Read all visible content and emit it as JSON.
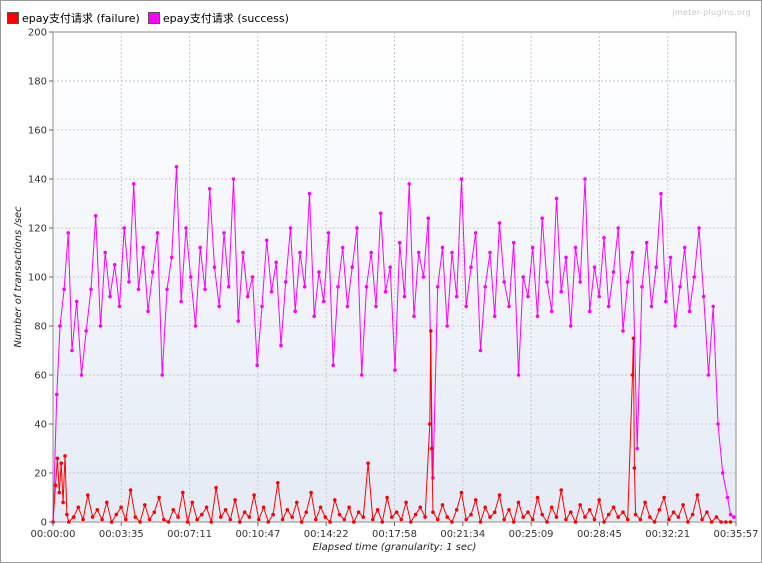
{
  "legend": {
    "failure_label": "epay支付请求 (failure)",
    "success_label": "epay支付请求 (success)"
  },
  "watermark": "jmeter-plugins.org",
  "colors": {
    "failure": "#ff0000",
    "success": "#ff00ff",
    "grid": "#c8c8c8",
    "plot_top": "#ffffff",
    "plot_bottom": "#e4ebf5"
  },
  "chart_data": {
    "type": "line",
    "xlabel": "Elapsed time (granularity: 1 sec)",
    "ylabel": "Number of transactions /sec",
    "ylim": [
      0,
      200
    ],
    "yticks": [
      0,
      20,
      40,
      60,
      80,
      100,
      120,
      140,
      160,
      180,
      200
    ],
    "xticks": [
      "00:00:00",
      "00:03:35",
      "00:07:11",
      "00:10:47",
      "00:14:22",
      "00:17:58",
      "00:21:34",
      "00:25:09",
      "00:28:45",
      "00:32:21",
      "00:35:57"
    ],
    "xlim_seconds": [
      0,
      2157
    ],
    "grid": true,
    "legend_position": "top-left",
    "series": [
      {
        "name": "epay支付请求 (success)",
        "color": "#ff00ff",
        "points": [
          [
            0,
            0
          ],
          [
            12,
            52
          ],
          [
            22,
            80
          ],
          [
            35,
            95
          ],
          [
            48,
            118
          ],
          [
            60,
            70
          ],
          [
            75,
            90
          ],
          [
            90,
            60
          ],
          [
            105,
            78
          ],
          [
            120,
            95
          ],
          [
            135,
            125
          ],
          [
            150,
            80
          ],
          [
            165,
            110
          ],
          [
            180,
            92
          ],
          [
            195,
            105
          ],
          [
            210,
            88
          ],
          [
            225,
            120
          ],
          [
            240,
            98
          ],
          [
            255,
            138
          ],
          [
            270,
            95
          ],
          [
            285,
            112
          ],
          [
            300,
            86
          ],
          [
            315,
            102
          ],
          [
            330,
            118
          ],
          [
            345,
            60
          ],
          [
            360,
            95
          ],
          [
            375,
            108
          ],
          [
            390,
            145
          ],
          [
            405,
            90
          ],
          [
            420,
            120
          ],
          [
            435,
            100
          ],
          [
            450,
            80
          ],
          [
            465,
            112
          ],
          [
            480,
            95
          ],
          [
            495,
            136
          ],
          [
            510,
            104
          ],
          [
            525,
            88
          ],
          [
            540,
            118
          ],
          [
            555,
            96
          ],
          [
            570,
            140
          ],
          [
            585,
            82
          ],
          [
            600,
            110
          ],
          [
            615,
            92
          ],
          [
            630,
            100
          ],
          [
            645,
            64
          ],
          [
            660,
            88
          ],
          [
            675,
            115
          ],
          [
            690,
            94
          ],
          [
            705,
            106
          ],
          [
            720,
            72
          ],
          [
            735,
            98
          ],
          [
            750,
            120
          ],
          [
            765,
            86
          ],
          [
            780,
            110
          ],
          [
            795,
            96
          ],
          [
            810,
            134
          ],
          [
            825,
            84
          ],
          [
            840,
            102
          ],
          [
            855,
            90
          ],
          [
            870,
            118
          ],
          [
            885,
            64
          ],
          [
            900,
            96
          ],
          [
            915,
            112
          ],
          [
            930,
            88
          ],
          [
            945,
            104
          ],
          [
            960,
            120
          ],
          [
            975,
            60
          ],
          [
            990,
            96
          ],
          [
            1005,
            110
          ],
          [
            1020,
            88
          ],
          [
            1035,
            126
          ],
          [
            1050,
            94
          ],
          [
            1065,
            104
          ],
          [
            1080,
            62
          ],
          [
            1095,
            114
          ],
          [
            1110,
            92
          ],
          [
            1125,
            138
          ],
          [
            1140,
            84
          ],
          [
            1155,
            110
          ],
          [
            1170,
            100
          ],
          [
            1185,
            124
          ],
          [
            1200,
            18
          ],
          [
            1215,
            96
          ],
          [
            1230,
            112
          ],
          [
            1245,
            80
          ],
          [
            1260,
            110
          ],
          [
            1275,
            92
          ],
          [
            1290,
            140
          ],
          [
            1305,
            88
          ],
          [
            1320,
            104
          ],
          [
            1335,
            118
          ],
          [
            1350,
            70
          ],
          [
            1365,
            96
          ],
          [
            1380,
            110
          ],
          [
            1395,
            84
          ],
          [
            1410,
            122
          ],
          [
            1425,
            98
          ],
          [
            1440,
            88
          ],
          [
            1455,
            114
          ],
          [
            1470,
            60
          ],
          [
            1485,
            100
          ],
          [
            1500,
            92
          ],
          [
            1515,
            112
          ],
          [
            1530,
            84
          ],
          [
            1545,
            124
          ],
          [
            1560,
            98
          ],
          [
            1575,
            86
          ],
          [
            1590,
            132
          ],
          [
            1605,
            94
          ],
          [
            1620,
            108
          ],
          [
            1635,
            80
          ],
          [
            1650,
            112
          ],
          [
            1665,
            98
          ],
          [
            1680,
            140
          ],
          [
            1695,
            86
          ],
          [
            1710,
            104
          ],
          [
            1725,
            92
          ],
          [
            1740,
            116
          ],
          [
            1755,
            88
          ],
          [
            1770,
            102
          ],
          [
            1785,
            120
          ],
          [
            1800,
            78
          ],
          [
            1815,
            98
          ],
          [
            1830,
            110
          ],
          [
            1845,
            30
          ],
          [
            1860,
            96
          ],
          [
            1875,
            114
          ],
          [
            1890,
            88
          ],
          [
            1905,
            104
          ],
          [
            1920,
            134
          ],
          [
            1935,
            90
          ],
          [
            1950,
            108
          ],
          [
            1965,
            80
          ],
          [
            1980,
            96
          ],
          [
            1995,
            112
          ],
          [
            2010,
            86
          ],
          [
            2025,
            100
          ],
          [
            2040,
            120
          ],
          [
            2055,
            92
          ],
          [
            2070,
            60
          ],
          [
            2085,
            88
          ],
          [
            2100,
            40
          ],
          [
            2115,
            20
          ],
          [
            2130,
            10
          ],
          [
            2140,
            3
          ],
          [
            2150,
            2
          ]
        ]
      },
      {
        "name": "epay支付请求 (failure)",
        "color": "#ff0000",
        "points": [
          [
            0,
            0
          ],
          [
            8,
            15
          ],
          [
            14,
            26
          ],
          [
            20,
            12
          ],
          [
            26,
            24
          ],
          [
            32,
            8
          ],
          [
            38,
            27
          ],
          [
            44,
            3
          ],
          [
            50,
            0
          ],
          [
            65,
            2
          ],
          [
            80,
            6
          ],
          [
            95,
            1
          ],
          [
            110,
            11
          ],
          [
            125,
            2
          ],
          [
            140,
            5
          ],
          [
            155,
            1
          ],
          [
            170,
            8
          ],
          [
            185,
            0
          ],
          [
            200,
            3
          ],
          [
            215,
            6
          ],
          [
            230,
            1
          ],
          [
            245,
            13
          ],
          [
            260,
            2
          ],
          [
            275,
            0
          ],
          [
            290,
            7
          ],
          [
            305,
            1
          ],
          [
            320,
            4
          ],
          [
            335,
            10
          ],
          [
            350,
            1
          ],
          [
            365,
            0
          ],
          [
            380,
            5
          ],
          [
            395,
            2
          ],
          [
            410,
            12
          ],
          [
            425,
            0
          ],
          [
            440,
            8
          ],
          [
            455,
            1
          ],
          [
            470,
            3
          ],
          [
            485,
            6
          ],
          [
            500,
            0
          ],
          [
            515,
            14
          ],
          [
            530,
            2
          ],
          [
            545,
            5
          ],
          [
            560,
            1
          ],
          [
            575,
            9
          ],
          [
            590,
            0
          ],
          [
            605,
            4
          ],
          [
            620,
            2
          ],
          [
            635,
            11
          ],
          [
            650,
            1
          ],
          [
            665,
            6
          ],
          [
            680,
            0
          ],
          [
            695,
            3
          ],
          [
            710,
            16
          ],
          [
            725,
            1
          ],
          [
            740,
            5
          ],
          [
            755,
            2
          ],
          [
            770,
            8
          ],
          [
            785,
            0
          ],
          [
            800,
            4
          ],
          [
            815,
            12
          ],
          [
            830,
            1
          ],
          [
            845,
            6
          ],
          [
            860,
            2
          ],
          [
            875,
            0
          ],
          [
            890,
            9
          ],
          [
            905,
            3
          ],
          [
            920,
            1
          ],
          [
            935,
            6
          ],
          [
            950,
            0
          ],
          [
            965,
            4
          ],
          [
            980,
            2
          ],
          [
            995,
            24
          ],
          [
            1010,
            1
          ],
          [
            1025,
            5
          ],
          [
            1040,
            0
          ],
          [
            1055,
            10
          ],
          [
            1070,
            2
          ],
          [
            1085,
            4
          ],
          [
            1100,
            1
          ],
          [
            1115,
            8
          ],
          [
            1130,
            0
          ],
          [
            1145,
            3
          ],
          [
            1160,
            6
          ],
          [
            1175,
            2
          ],
          [
            1190,
            40
          ],
          [
            1193,
            78
          ],
          [
            1196,
            30
          ],
          [
            1200,
            4
          ],
          [
            1215,
            1
          ],
          [
            1230,
            7
          ],
          [
            1245,
            2
          ],
          [
            1260,
            0
          ],
          [
            1275,
            5
          ],
          [
            1290,
            12
          ],
          [
            1305,
            1
          ],
          [
            1320,
            3
          ],
          [
            1335,
            9
          ],
          [
            1350,
            0
          ],
          [
            1365,
            6
          ],
          [
            1380,
            2
          ],
          [
            1395,
            4
          ],
          [
            1410,
            11
          ],
          [
            1425,
            1
          ],
          [
            1440,
            5
          ],
          [
            1455,
            0
          ],
          [
            1470,
            8
          ],
          [
            1485,
            2
          ],
          [
            1500,
            4
          ],
          [
            1515,
            1
          ],
          [
            1530,
            10
          ],
          [
            1545,
            3
          ],
          [
            1560,
            0
          ],
          [
            1575,
            6
          ],
          [
            1590,
            2
          ],
          [
            1605,
            13
          ],
          [
            1620,
            1
          ],
          [
            1635,
            4
          ],
          [
            1650,
            0
          ],
          [
            1665,
            7
          ],
          [
            1680,
            2
          ],
          [
            1695,
            5
          ],
          [
            1710,
            1
          ],
          [
            1725,
            9
          ],
          [
            1740,
            0
          ],
          [
            1755,
            3
          ],
          [
            1770,
            6
          ],
          [
            1785,
            2
          ],
          [
            1800,
            4
          ],
          [
            1815,
            1
          ],
          [
            1830,
            60
          ],
          [
            1833,
            75
          ],
          [
            1836,
            22
          ],
          [
            1840,
            3
          ],
          [
            1855,
            1
          ],
          [
            1870,
            8
          ],
          [
            1885,
            2
          ],
          [
            1900,
            0
          ],
          [
            1915,
            5
          ],
          [
            1930,
            10
          ],
          [
            1945,
            1
          ],
          [
            1960,
            4
          ],
          [
            1975,
            2
          ],
          [
            1990,
            7
          ],
          [
            2005,
            0
          ],
          [
            2020,
            3
          ],
          [
            2035,
            11
          ],
          [
            2050,
            1
          ],
          [
            2065,
            4
          ],
          [
            2080,
            0
          ],
          [
            2095,
            2
          ],
          [
            2110,
            0
          ],
          [
            2125,
            0
          ],
          [
            2140,
            0
          ]
        ]
      }
    ]
  }
}
